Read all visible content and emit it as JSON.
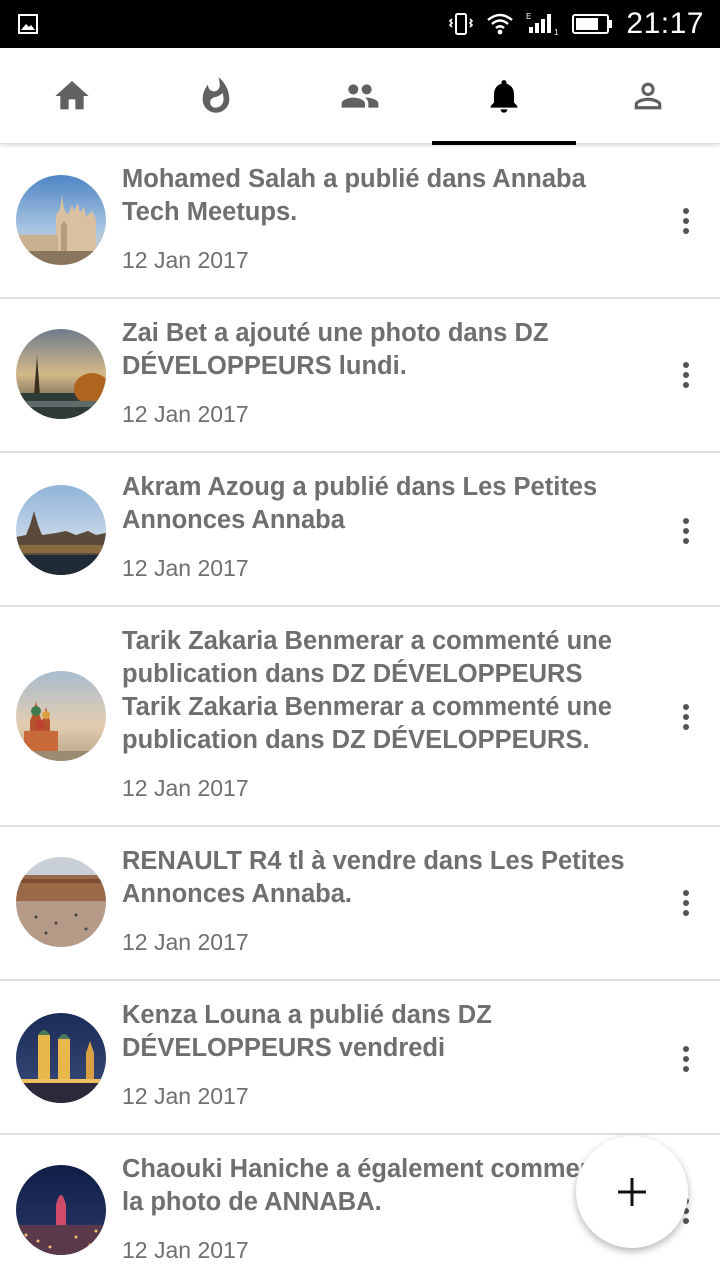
{
  "status_bar": {
    "time": "21:17",
    "icons": [
      "gallery-icon",
      "vibrate-icon",
      "wifi-icon",
      "signal-icon",
      "battery-icon"
    ]
  },
  "tabs": [
    {
      "name": "home",
      "icon": "home-icon",
      "active": false
    },
    {
      "name": "trending",
      "icon": "flame-icon",
      "active": false
    },
    {
      "name": "groups",
      "icon": "people-icon",
      "active": false
    },
    {
      "name": "notifications",
      "icon": "bell-icon",
      "active": true
    },
    {
      "name": "profile",
      "icon": "person-icon",
      "active": false
    }
  ],
  "notifications": [
    {
      "text": "Mohamed Salah a publié dans Annaba Tech Meetups.",
      "date": "12 Jan 2017",
      "avatar": "milan-cathedral"
    },
    {
      "text": "Zai Bet a ajouté une photo dans DZ DÉVELOPPEURS lundi.",
      "date": "12 Jan 2017",
      "avatar": "paris-eiffel"
    },
    {
      "text": "Akram Azoug a publié dans Les Petites Annonces Annaba",
      "date": "12 Jan 2017",
      "avatar": "london-parliament"
    },
    {
      "text": "Tarik Zakaria Benmerar a commenté une publication dans DZ DÉVELOPPEURS Tarik Zakaria Benmerar a commenté une publication dans DZ DÉVELOPPEURS.",
      "date": "12 Jan 2017",
      "avatar": "moscow-basil"
    },
    {
      "text": "RENAULT R4 tl à vendre dans Les Petites Annonces Annaba.",
      "date": "12 Jan 2017",
      "avatar": "madrid-plaza"
    },
    {
      "text": "Kenza Louna a publié dans DZ DÉVELOPPEURS vendredi",
      "date": "12 Jan 2017",
      "avatar": "munich-night"
    },
    {
      "text": "Chaouki Haniche a également commenté la photo de ANNABA.",
      "date": "12 Jan 2017",
      "avatar": "barcelona-night"
    }
  ],
  "fab": {
    "icon": "plus-icon"
  }
}
